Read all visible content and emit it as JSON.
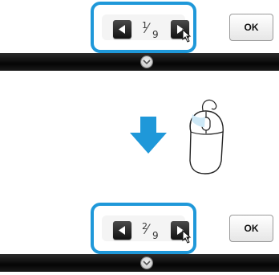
{
  "steps": [
    {
      "pager": {
        "current": "1",
        "total": "9",
        "prev_icon": "triangle-left-icon",
        "next_icon": "triangle-right-icon"
      },
      "ok_label": "OK"
    },
    {
      "pager": {
        "current": "2",
        "total": "9",
        "prev_icon": "triangle-left-icon",
        "next_icon": "triangle-right-icon"
      },
      "ok_label": "OK"
    }
  ],
  "transition_icon": "arrow-down-icon",
  "input_device_icon": "mouse-icon",
  "colors": {
    "highlight": "#1f98d9",
    "arrow": "#1f98d9",
    "bar": "#000000"
  }
}
